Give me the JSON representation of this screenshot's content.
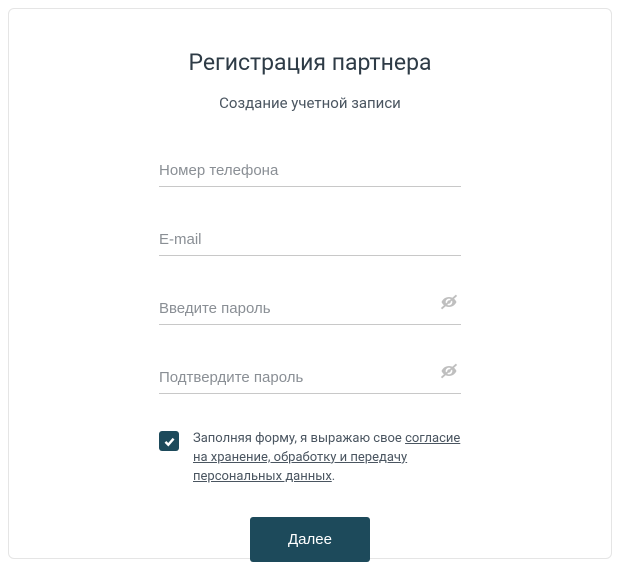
{
  "title": "Регистрация партнера",
  "subtitle": "Создание учетной записи",
  "fields": {
    "phone": {
      "placeholder": "Номер телефона",
      "value": ""
    },
    "email": {
      "placeholder": "E-mail",
      "value": ""
    },
    "password": {
      "placeholder": "Введите пароль",
      "value": ""
    },
    "password_confirm": {
      "placeholder": "Подтвердите пароль",
      "value": ""
    }
  },
  "consent": {
    "checked": true,
    "text_prefix": "Заполняя форму, я выражаю свое ",
    "link_text": "согласие на хранение, обработку и передачу персональных данных",
    "text_suffix": "."
  },
  "submit": {
    "label": "Далее"
  },
  "colors": {
    "accent": "#1d4a5b",
    "text_primary": "#2e3b46",
    "text_secondary": "#4a5560",
    "placeholder": "#8a8f95",
    "border": "#c8c8c8"
  }
}
